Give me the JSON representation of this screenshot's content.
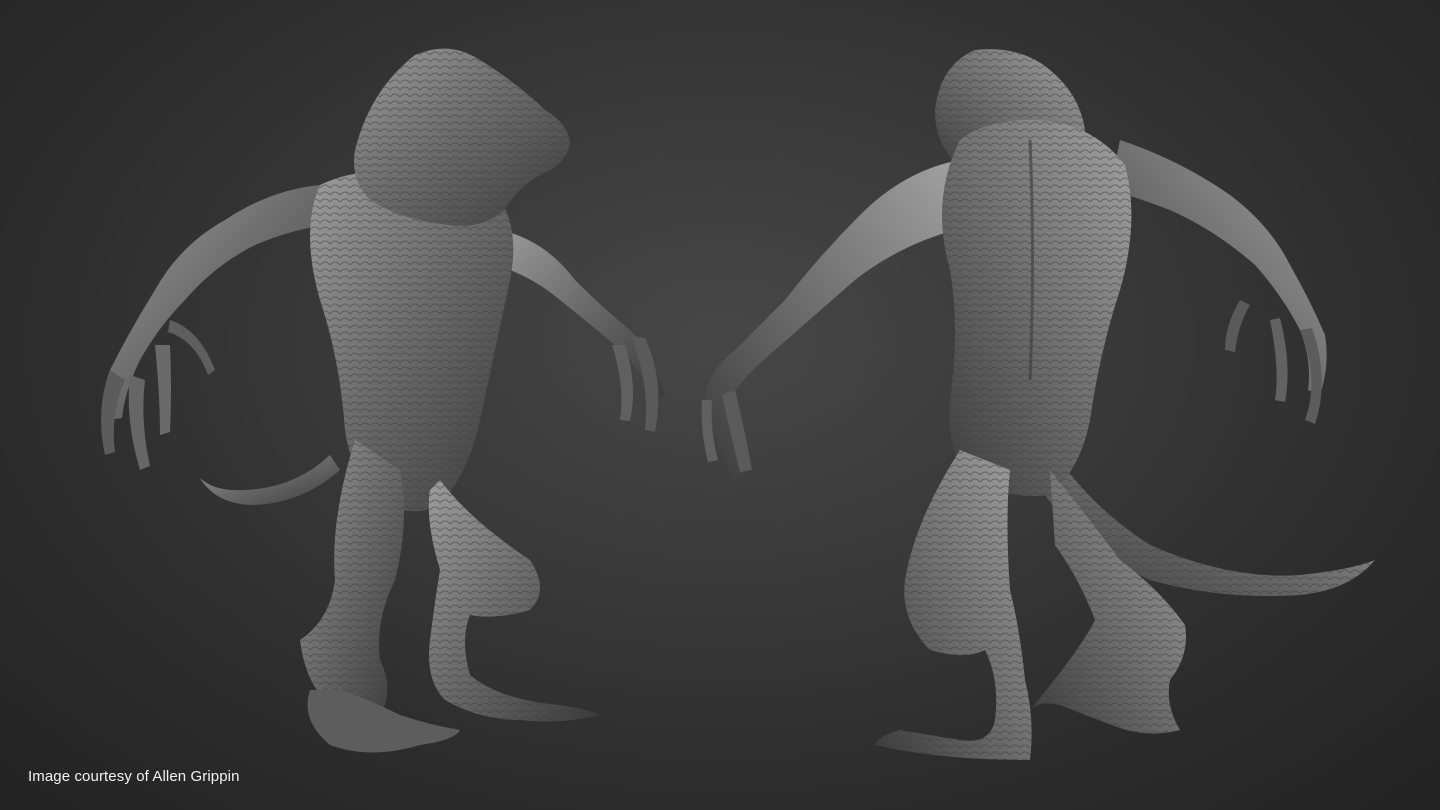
{
  "scene": {
    "subject": "creature-sculpt-turnaround",
    "background_color": "#2f2f2f",
    "sculpt_color": "#6b6b6b",
    "highlight_color": "#9a9a9a",
    "shadow_color": "#2a2a2a"
  },
  "credit": {
    "text": "Image courtesy of Allen Grippin",
    "color": "#f2f2f2"
  }
}
